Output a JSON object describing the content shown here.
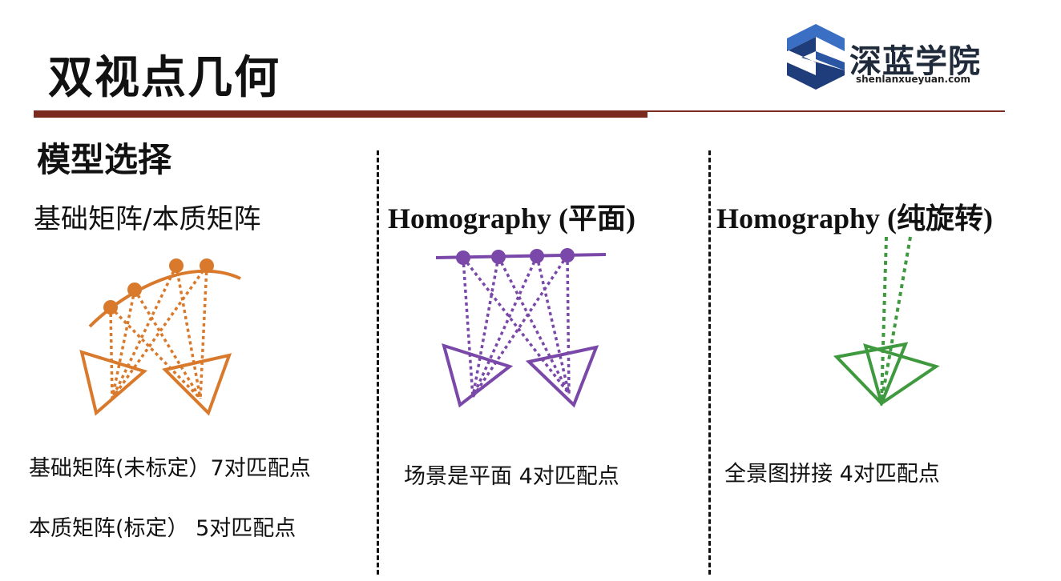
{
  "header": {
    "title": "双视点几何",
    "subtitle": "模型选择"
  },
  "logo": {
    "name": "深蓝学院",
    "url_text": "shenlanxueyuan.com",
    "colors": {
      "dark": "#1f3d7a",
      "light": "#3b6fc4"
    }
  },
  "columns": [
    {
      "heading": "基础矩阵/本质矩阵",
      "color": "#d9792b",
      "notes": [
        "基础矩阵(未标定）7对匹配点",
        "本质矩阵(标定）  5对匹配点"
      ]
    },
    {
      "heading": "Homography (平面)",
      "color": "#7a48a8",
      "notes": [
        "场景是平面  4对匹配点"
      ]
    },
    {
      "heading": "Homography (纯旋转)",
      "color": "#3f9a3f",
      "notes": [
        "全景图拼接 4对匹配点"
      ]
    }
  ],
  "accent_color": "#7b2a20"
}
